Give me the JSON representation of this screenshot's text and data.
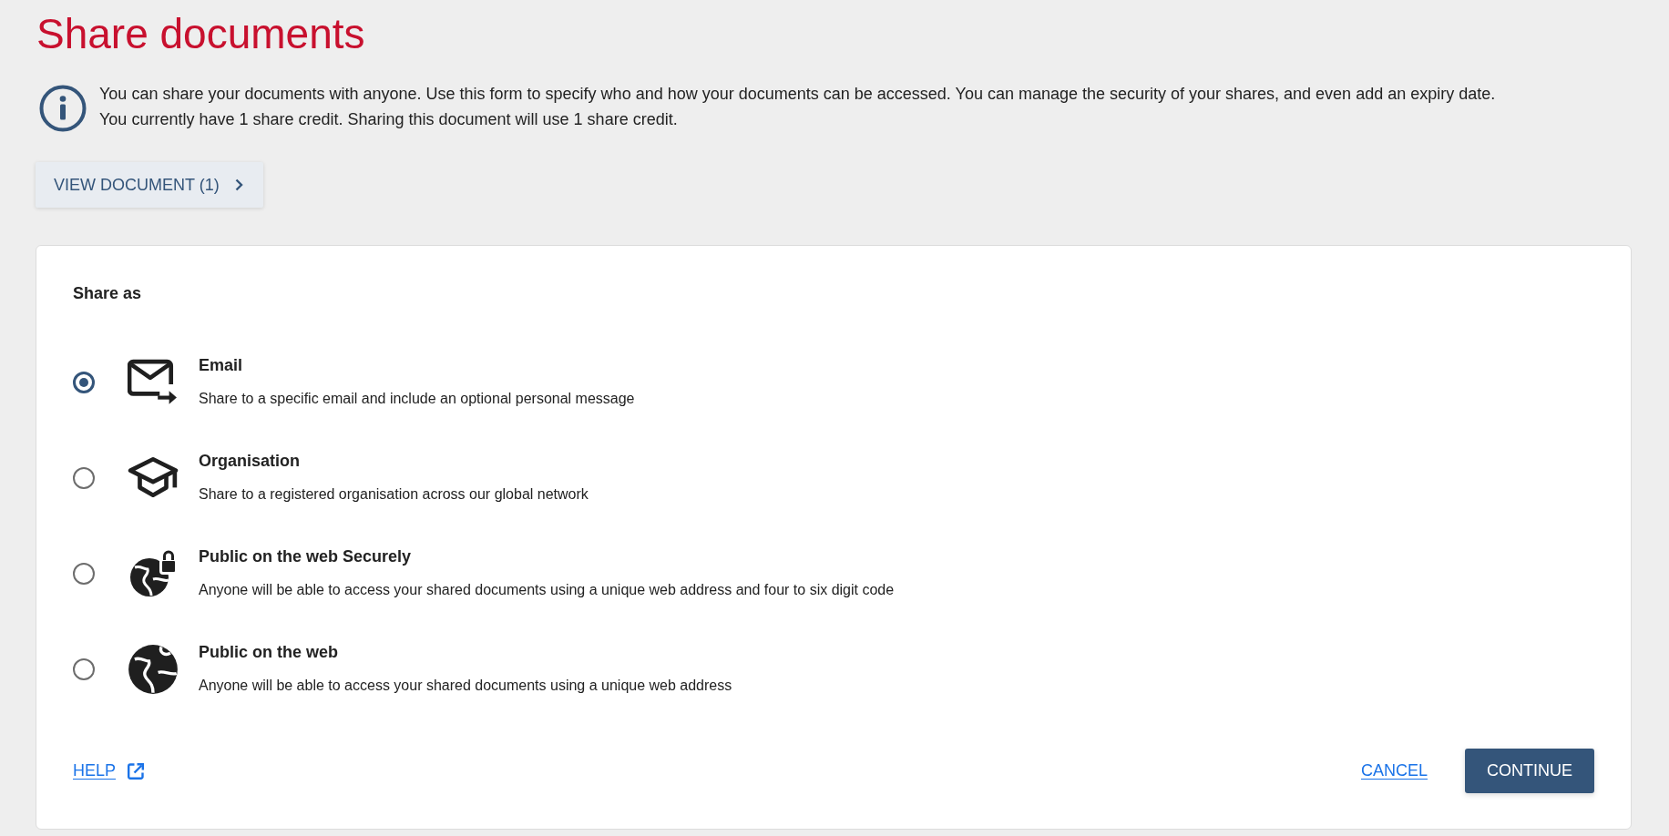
{
  "title": "Share documents",
  "info": {
    "lines": [
      "You can share your documents with anyone. Use this form to specify who and how your documents can be accessed. You can manage the security of your shares, and even add an expiry date.",
      "You currently have 1 share credit. Sharing this document will use 1 share credit."
    ]
  },
  "view_button": {
    "label": "VIEW DOCUMENT (1)"
  },
  "share_form": {
    "heading": "Share as",
    "options": [
      {
        "kind": "email",
        "title": "Email",
        "description": "Share to a specific email and include an optional personal message",
        "selected": true
      },
      {
        "kind": "organisation",
        "title": "Organisation",
        "description": "Share to a registered organisation across our global network",
        "selected": false
      },
      {
        "kind": "public_secure",
        "title": "Public on the web Securely",
        "description": "Anyone will be able to access your shared documents using a unique web address and four to six digit code",
        "selected": false
      },
      {
        "kind": "public",
        "title": "Public on the web",
        "description": "Anyone will be able to access your shared documents using a unique web address",
        "selected": false
      }
    ]
  },
  "footer": {
    "help_link": "HELP",
    "cancel": "CANCEL",
    "continue": "CONTINUE"
  }
}
